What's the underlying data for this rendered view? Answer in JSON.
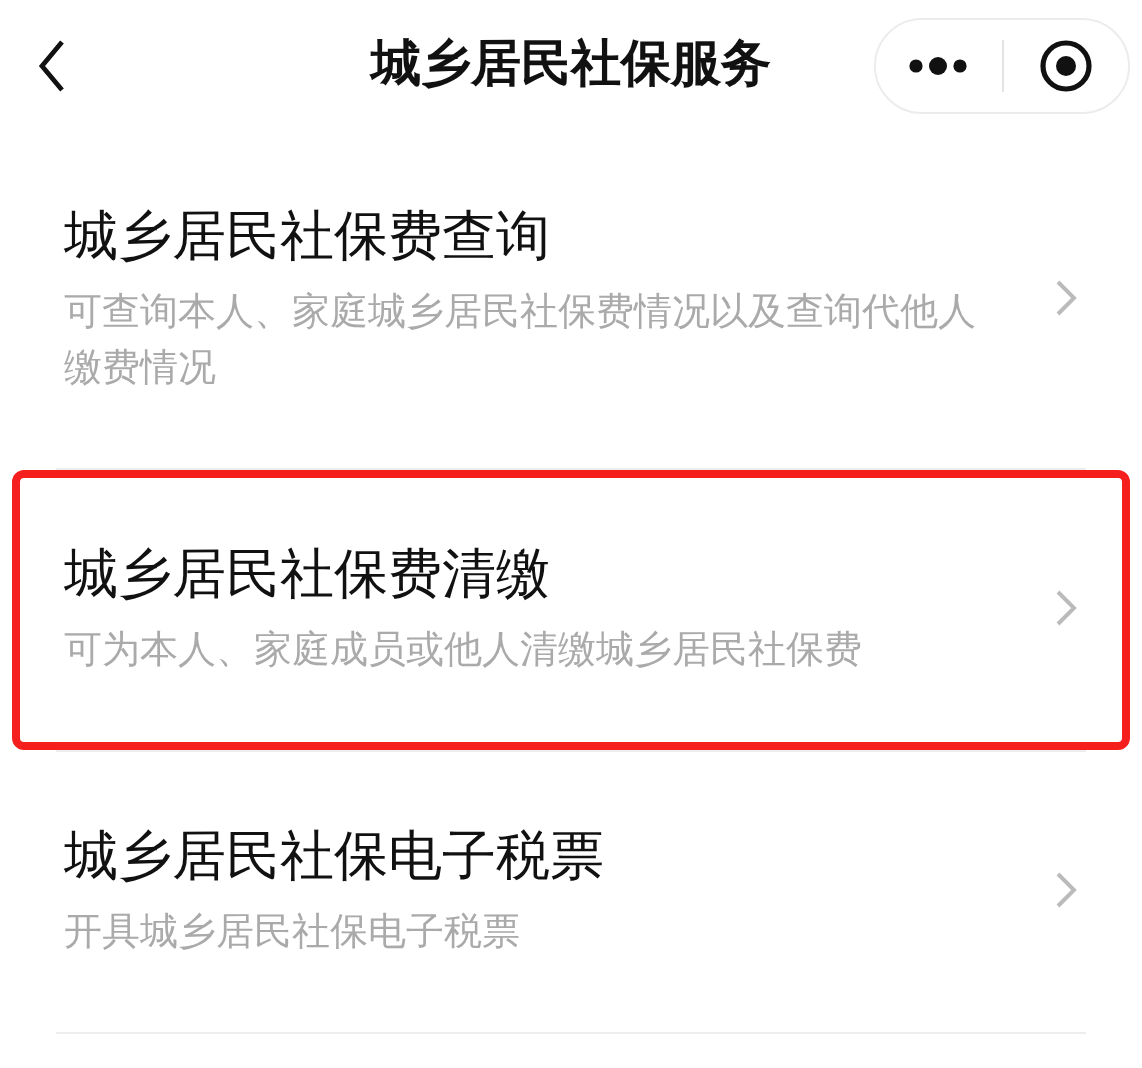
{
  "header": {
    "title": "城乡居民社保服务"
  },
  "items": [
    {
      "title": "城乡居民社保费查询",
      "description": "可查询本人、家庭城乡居民社保费情况以及查询代他人缴费情况",
      "highlighted": false
    },
    {
      "title": "城乡居民社保费清缴",
      "description": "可为本人、家庭成员或他人清缴城乡居民社保费",
      "highlighted": true
    },
    {
      "title": "城乡居民社保电子税票",
      "description": "开具城乡居民社保电子税票",
      "highlighted": false
    }
  ]
}
